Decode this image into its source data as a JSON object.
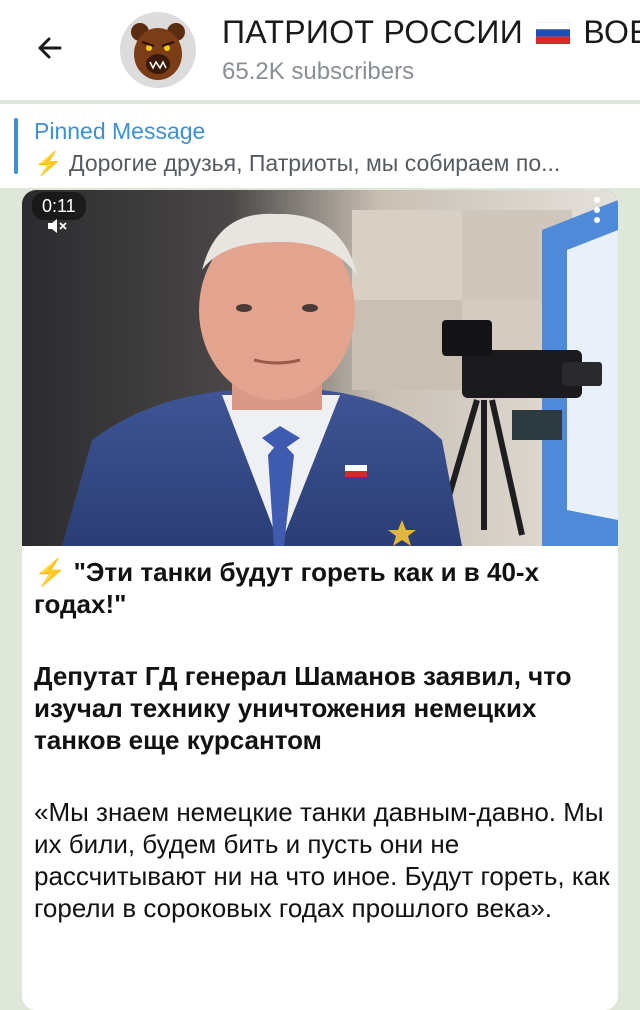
{
  "header": {
    "channel_title": "ПАТРИОТ РОССИИ",
    "channel_title_tail": "ВОЕ",
    "subscribers": "65.2K subscribers",
    "back_icon": "arrow-left-icon",
    "avatar_icon": "bear-avatar-icon"
  },
  "pinned": {
    "title": "Pinned Message",
    "emoji": "⚡",
    "text": "Дорогие друзья, Патриоты, мы собираем по..."
  },
  "video": {
    "time": "0:11",
    "mute_icon": "speaker-muted-icon",
    "menu_icon": "more-vertical-icon"
  },
  "message": {
    "headline_emoji": "⚡",
    "headline": "\"Эти танки будут гореть как и в 40-х годах!\"",
    "subheadline": "Депутат ГД генерал Шаманов заявил, что изучал технику уничтожения немецких танков еще  курсантом",
    "quote": "«Мы знаем немецкие танки давным-давно. Мы их били, будем бить и пусть они не рассчитывают  ни на что иное. Будут гореть, как горели в сороковых годах прошлого века»."
  },
  "colors": {
    "accent": "#3d8fd6",
    "background": "#dfe7d8",
    "bubble": "#ffffff"
  }
}
